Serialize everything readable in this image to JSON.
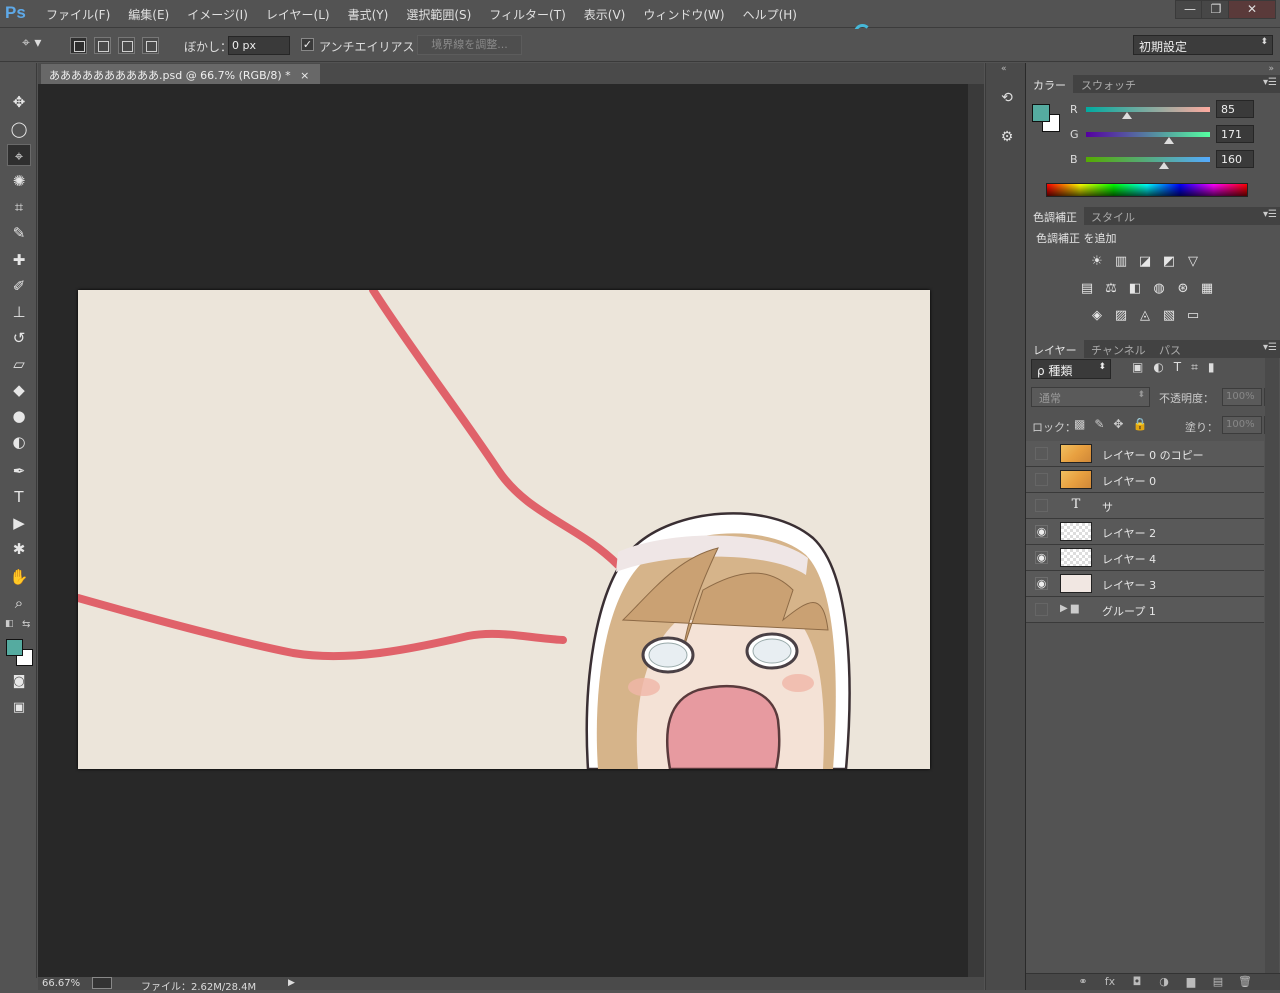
{
  "app": {
    "logo": "Ps"
  },
  "menu": [
    "ファイル(F)",
    "編集(E)",
    "イメージ(I)",
    "レイヤー(L)",
    "書式(Y)",
    "選択範囲(S)",
    "フィルター(T)",
    "表示(V)",
    "ウィンドウ(W)",
    "ヘルプ(H)"
  ],
  "window_controls": {
    "minimize": "—",
    "restore": "❐",
    "close": "✕"
  },
  "options": {
    "feather_label": "ぼかし：",
    "feather_value": "0 px",
    "antialias_checked": "✓",
    "antialias_label": "アンチエイリアス",
    "refine_edge": "境界線を調整...",
    "workspace_preset": "初期設定"
  },
  "document": {
    "tab_title": "ああああああああああ.psd @ 66.7% (RGB/8) *",
    "close_glyph": "×"
  },
  "status": {
    "zoom": "66.67%",
    "file": "ファイル：2.62M/28.4M",
    "arrow": "▶"
  },
  "tools": [
    {
      "name": "move-tool-icon",
      "glyph": "✥"
    },
    {
      "name": "elliptical-marquee-tool-icon",
      "glyph": "◯"
    },
    {
      "name": "polygonal-lasso-tool-icon",
      "glyph": "⌖"
    },
    {
      "name": "magic-wand-tool-icon",
      "glyph": "✺"
    },
    {
      "name": "crop-tool-icon",
      "glyph": "⌗"
    },
    {
      "name": "eyedropper-tool-icon",
      "glyph": "✎"
    },
    {
      "name": "spot-healing-tool-icon",
      "glyph": "✚"
    },
    {
      "name": "brush-tool-icon",
      "glyph": "✐"
    },
    {
      "name": "clone-stamp-tool-icon",
      "glyph": "⊥"
    },
    {
      "name": "history-brush-tool-icon",
      "glyph": "↺"
    },
    {
      "name": "eraser-tool-icon",
      "glyph": "▱"
    },
    {
      "name": "paint-bucket-tool-icon",
      "glyph": "◆"
    },
    {
      "name": "blur-tool-icon",
      "glyph": "●"
    },
    {
      "name": "dodge-tool-icon",
      "glyph": "◐"
    },
    {
      "name": "pen-tool-icon",
      "glyph": "✒"
    },
    {
      "name": "type-tool-icon",
      "glyph": "T"
    },
    {
      "name": "path-selection-tool-icon",
      "glyph": "▶"
    },
    {
      "name": "custom-shape-tool-icon",
      "glyph": "✱"
    },
    {
      "name": "hand-tool-icon",
      "glyph": "✋"
    },
    {
      "name": "zoom-tool-icon",
      "glyph": "⌕"
    }
  ],
  "colors": {
    "foreground": "#55aba0",
    "background": "#ffffff",
    "canvas": "#ece5da",
    "stroke": "#e0626a",
    "accent": "#46b8d8"
  },
  "color_panel": {
    "tabs": [
      "カラー",
      "スウォッチ"
    ],
    "channels": [
      {
        "label": "R",
        "value": "85",
        "fraction": 0.333
      },
      {
        "label": "G",
        "value": "171",
        "fraction": 0.671
      },
      {
        "label": "B",
        "value": "160",
        "fraction": 0.627
      }
    ]
  },
  "adjustments_panel": {
    "tabs": [
      "色調補正",
      "スタイル"
    ],
    "add_label": "色調補正 を追加",
    "rows": [
      [
        "brightness-contrast-icon",
        "levels-icon",
        "curves-icon",
        "exposure-icon",
        "vibrance-icon"
      ],
      [
        "hue-saturation-icon",
        "color-balance-icon",
        "black-white-icon",
        "photo-filter-icon",
        "channel-mixer-icon",
        "color-lookup-icon"
      ],
      [
        "invert-icon",
        "posterize-icon",
        "threshold-icon",
        "selective-color-icon",
        "gradient-map-icon"
      ]
    ],
    "glyphs": [
      [
        "☀",
        "▥",
        "◪",
        "◩",
        "▽"
      ],
      [
        "▤",
        "⚖",
        "◧",
        "◍",
        "⊛",
        "▦"
      ],
      [
        "◈",
        "▨",
        "◬",
        "▧",
        "▭"
      ]
    ]
  },
  "layers_panel": {
    "tabs": [
      "レイヤー",
      "チャンネル",
      "パス"
    ],
    "filter_label": "ρ 種類",
    "blend_mode": "通常",
    "opacity_label": "不透明度：",
    "opacity_value": "100%",
    "lock_label": "ロック：",
    "fill_label": "塗り：",
    "fill_value": "100%",
    "layers": [
      {
        "name": "レイヤー 0 のコピー",
        "visible": "",
        "thumb": "photo"
      },
      {
        "name": "レイヤー 0",
        "visible": "",
        "thumb": "photo"
      },
      {
        "name": "サ",
        "visible": "",
        "thumb": "text",
        "glyph": "T"
      },
      {
        "name": "レイヤー 2",
        "visible": "◉",
        "thumb": "checker"
      },
      {
        "name": "レイヤー 4",
        "visible": "◉",
        "thumb": "checker"
      },
      {
        "name": "レイヤー 3",
        "visible": "◉",
        "thumb": "light"
      },
      {
        "name": "グループ 1",
        "visible": "",
        "thumb": "folder",
        "glyph": "▶ ▆"
      }
    ]
  }
}
